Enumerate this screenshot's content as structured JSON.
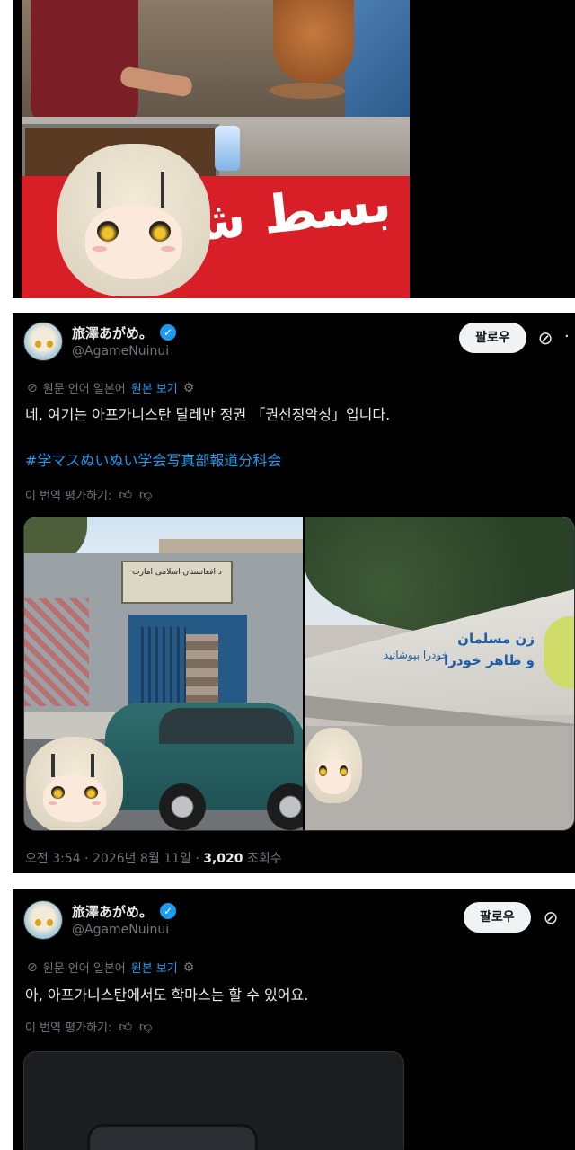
{
  "top_post": {
    "photo_sign_text": "بسط شورمه"
  },
  "tweet1": {
    "display_name": "旅澤あがめ。",
    "handle": "@AgameNuinui",
    "follow_label": "팔로우",
    "translation_note": "원문 언어 일본어",
    "show_original": "원본 보기",
    "text": "네, 여기는 아프가니스탄 탈레반 정권 「권선징악성」입니다.",
    "hashtag": "#学マスぬいぬい学会写真部報道分科会",
    "rate_translation": "이 번역 평가하기:",
    "timestamp": "오전 3:54 · 2026년 8월 11일 · ",
    "views_count": "3,020",
    "views_label": " 조회수",
    "photo_right_text1": "زن مسلمان",
    "photo_right_text2": "و ظاهر خودرا",
    "photo_right_text3": "خودرا بپوشانید"
  },
  "tweet2": {
    "display_name": "旅澤あがめ。",
    "handle": "@AgameNuinui",
    "follow_label": "팔로우",
    "translation_note": "원문 언어 일본어",
    "show_original": "원본 보기",
    "text": "아, 아프가니스탄에서도 학마스는 할 수 있어요.",
    "rate_translation": "이 번역 평가하기:"
  },
  "colors": {
    "background": "#000000",
    "link": "#1d9bf0",
    "muted": "#71767b",
    "text": "#e7e9ea"
  },
  "icons": [
    "verified-icon",
    "grok-icon",
    "more-icon",
    "settings-icon",
    "translate-icon",
    "thumbs-up-icon",
    "thumbs-down-icon"
  ]
}
